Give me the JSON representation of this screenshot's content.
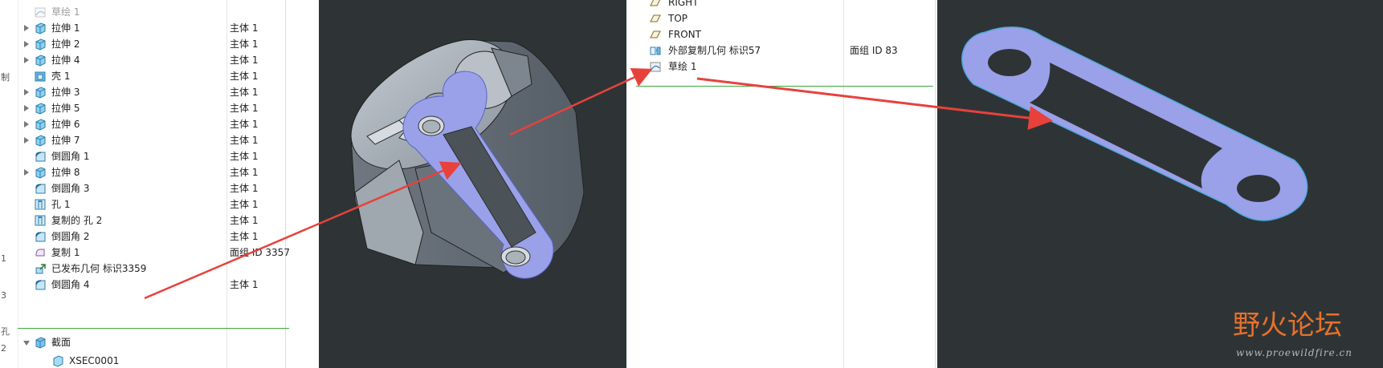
{
  "left_gutter": [
    "制",
    "1",
    "3",
    "孔",
    "2"
  ],
  "left_tree": [
    {
      "label": "草绘 1",
      "value": "",
      "icon": "sketch-icon",
      "expand": false,
      "faded": true
    },
    {
      "label": "拉伸 1",
      "value": "主体 1",
      "icon": "extrude-icon",
      "expand": true
    },
    {
      "label": "拉伸 2",
      "value": "主体 1",
      "icon": "extrude-icon",
      "expand": true
    },
    {
      "label": "拉伸 4",
      "value": "主体 1",
      "icon": "extrude-icon",
      "expand": true
    },
    {
      "label": "壳 1",
      "value": "主体 1",
      "icon": "shell-icon",
      "expand": false
    },
    {
      "label": "拉伸 3",
      "value": "主体 1",
      "icon": "extrude-icon",
      "expand": true
    },
    {
      "label": "拉伸 5",
      "value": "主体 1",
      "icon": "extrude-icon",
      "expand": true
    },
    {
      "label": "拉伸 6",
      "value": "主体 1",
      "icon": "extrude-icon",
      "expand": true
    },
    {
      "label": "拉伸 7",
      "value": "主体 1",
      "icon": "extrude-icon",
      "expand": true
    },
    {
      "label": "倒圆角 1",
      "value": "主体 1",
      "icon": "round-icon",
      "expand": false
    },
    {
      "label": "拉伸 8",
      "value": "主体 1",
      "icon": "extrude-icon",
      "expand": true
    },
    {
      "label": "倒圆角 3",
      "value": "主体 1",
      "icon": "round-icon",
      "expand": false
    },
    {
      "label": "孔 1",
      "value": "主体 1",
      "icon": "hole-icon",
      "expand": false
    },
    {
      "label": "复制的 孔 2",
      "value": "主体 1",
      "icon": "hole-icon",
      "expand": false
    },
    {
      "label": "倒圆角 2",
      "value": "主体 1",
      "icon": "round-icon",
      "expand": false
    },
    {
      "label": "复制 1",
      "value": "面组 ID 3357",
      "icon": "copy-icon",
      "expand": false
    },
    {
      "label": "已发布几何 标识3359",
      "value": "",
      "icon": "publish-geom-icon",
      "expand": false
    },
    {
      "label": "倒圆角 4",
      "value": "主体 1",
      "icon": "round-icon",
      "expand": false
    }
  ],
  "sections": {
    "label": "截面",
    "child": "XSEC0001"
  },
  "right_tree": [
    {
      "label": "RIGHT",
      "value": "",
      "icon": "datum-plane-icon"
    },
    {
      "label": "TOP",
      "value": "",
      "icon": "datum-plane-icon"
    },
    {
      "label": "FRONT",
      "value": "",
      "icon": "datum-plane-icon"
    },
    {
      "label": "外部复制几何 标识57",
      "value": "面组 ID 83",
      "icon": "external-copy-geom-icon"
    },
    {
      "label": "草绘 1",
      "value": "",
      "icon": "sketch-icon"
    }
  ],
  "watermark": {
    "title": "野火论坛",
    "url": "www.proewildfire.cn"
  },
  "colors": {
    "viewport_bg": "#2e3435",
    "highlight": "#9aa1e8",
    "arrow": "#e8413c",
    "separator": "#3aa83a"
  }
}
